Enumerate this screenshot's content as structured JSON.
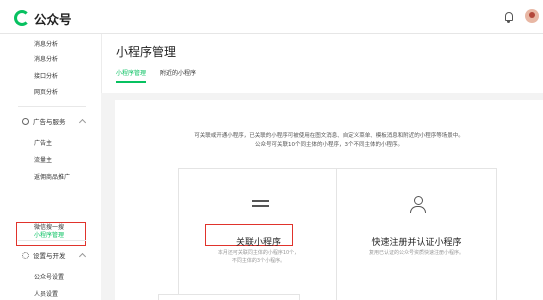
{
  "header": {
    "brand": "公众号",
    "icons": [
      "wechat-logo-icon",
      "bell-icon",
      "avatar"
    ]
  },
  "sidebar": {
    "top_items": [
      "消息分析",
      "消息分析",
      "接口分析",
      "网页分析"
    ],
    "groups": [
      {
        "label": "广告与服务",
        "icon": "circle-icon",
        "items": [
          "广告主",
          "流量主",
          "返佣商品推广",
          "小程序管理",
          "微信搜一搜"
        ]
      },
      {
        "label": "设置与开发",
        "icon": "gear-icon",
        "items": [
          "公众号设置",
          "人员设置"
        ]
      }
    ],
    "active_item": "小程序管理"
  },
  "main": {
    "title": "小程序管理",
    "tabs": [
      {
        "label": "小程序管理",
        "active": true
      },
      {
        "label": "附近的小程序",
        "active": false
      }
    ],
    "intro_line1": "可关联或开通小程序，已关联的小程序可被使用在图文消息、自定义菜单、模板消息和附近的小程序等场景中。",
    "intro_line2": "公众号可关联10个同主体的小程序，3个不同主体的小程序。",
    "cards": [
      {
        "title": "关联小程序",
        "icon": "swap-arrows-icon",
        "desc_line1": "本月还可关联同主体的小程序10个，",
        "desc_line2": "不同主体的3个小程序。"
      },
      {
        "title": "快速注册并认证小程序",
        "icon": "user-icon",
        "desc_line1": "复用已认证的公众号资质快速注册小程序。",
        "desc_line2": ""
      }
    ]
  },
  "colors": {
    "accent": "#07c160",
    "highlight_box": "#e0332c",
    "background": "#f3f3f3"
  }
}
